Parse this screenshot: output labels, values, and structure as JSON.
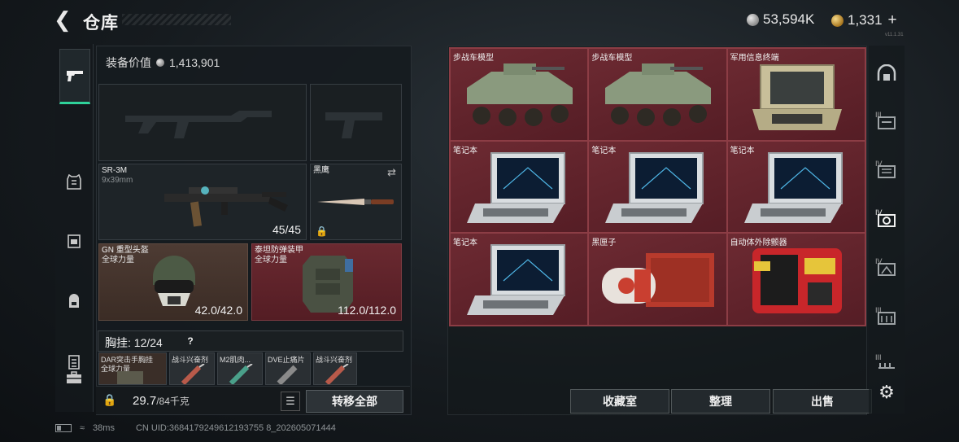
{
  "header": {
    "title": "仓库",
    "silver_amount": "53,594K",
    "gold_amount": "1,331",
    "plus": "+",
    "version": "v11.1.31"
  },
  "left_nav": {
    "items": [
      {
        "icon": "pistol-icon"
      },
      {
        "icon": "armor-icon"
      },
      {
        "icon": "rig-icon"
      },
      {
        "icon": "backpack-icon"
      },
      {
        "icon": "case-icon"
      },
      {
        "icon": "briefcase-icon"
      }
    ]
  },
  "equipment": {
    "value_label": "装备价值",
    "value": "1,413,901",
    "primary_weapon": {
      "name": "SR-3M",
      "caliber": "9x39mm",
      "ammo": "45/45"
    },
    "melee": {
      "name": "黑鹰"
    },
    "helmet": {
      "name": "GN 重型头盔",
      "sub": "全球力量",
      "durability": "42.0/42.0"
    },
    "armor": {
      "name": "泰坦防弹装甲",
      "sub": "全球力量",
      "durability": "112.0/112.0"
    },
    "chest_rig": {
      "label": "胸挂: 12/24",
      "help": "?"
    },
    "rig_items": [
      {
        "name": "DAR突击手胸挂",
        "sub": "全球力量"
      },
      {
        "name": "战斗兴奋剂"
      },
      {
        "name": "M2肌肉..."
      },
      {
        "name": "DVE止痛片"
      },
      {
        "name": "战斗兴奋剂"
      }
    ],
    "weight": "29.7",
    "weight_unit": "/84千克",
    "transfer_all": "转移全部"
  },
  "warehouse": {
    "items": [
      {
        "name": "步战车模型",
        "kind": "vehicle"
      },
      {
        "name": "步战车模型",
        "kind": "vehicle"
      },
      {
        "name": "军用信息终端",
        "kind": "terminal"
      },
      {
        "name": "笔记本",
        "kind": "laptop"
      },
      {
        "name": "笔记本",
        "kind": "laptop"
      },
      {
        "name": "笔记本",
        "kind": "laptop"
      },
      {
        "name": "笔记本",
        "kind": "laptop"
      },
      {
        "name": "黑匣子",
        "kind": "blackbox"
      },
      {
        "name": "自动体外除颤器",
        "kind": "aed"
      }
    ],
    "buttons": {
      "collection": "收藏室",
      "sort": "整理",
      "sell": "出售"
    }
  },
  "right_nav": {
    "items": [
      {
        "icon": "dome-icon"
      },
      {
        "icon": "tier-iii-icon",
        "level": "III"
      },
      {
        "icon": "tier-iv-icon",
        "level": "IV"
      },
      {
        "icon": "tier-iv-active-icon",
        "level": "IV"
      },
      {
        "icon": "tier-iv-b-icon",
        "level": "IV"
      },
      {
        "icon": "tier-iii-b-icon",
        "level": "III"
      },
      {
        "icon": "tier-iii-c-icon",
        "level": "III"
      },
      {
        "icon": "gear-icon"
      }
    ]
  },
  "status_bar": {
    "ping": "38ms",
    "uid": "CN UID:3684179249612193755 8_202605071444"
  },
  "colors": {
    "accent": "#2fd29a",
    "item_red": "#6d2a32"
  }
}
